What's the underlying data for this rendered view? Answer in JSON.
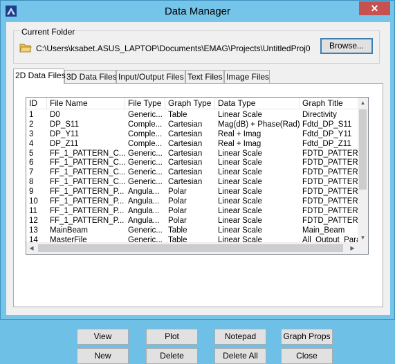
{
  "window": {
    "title": "Data Manager",
    "close_glyph": "✕"
  },
  "folder": {
    "legend": "Current Folder",
    "path": "C:\\Users\\ksabet.ASUS_LAPTOP\\Documents\\EMAG\\Projects\\UntitledProj0",
    "browse_label": "Browse..."
  },
  "tabs": [
    {
      "label": "2D Data Files",
      "active": true
    },
    {
      "label": "3D Data Files",
      "active": false
    },
    {
      "label": "Input/Output Files",
      "active": false
    },
    {
      "label": "Text Files",
      "active": false
    },
    {
      "label": "Image Files",
      "active": false
    }
  ],
  "table": {
    "columns": [
      "ID",
      "File Name",
      "File Type",
      "Graph Type",
      "Data Type",
      "Graph Title"
    ],
    "rows": [
      [
        "1",
        "D0",
        "Generic...",
        "Table",
        "Linear Scale",
        "Directivity"
      ],
      [
        "2",
        "DP_S11",
        "Comple...",
        "Cartesian",
        "Mag(dB) + Phase(Rad)",
        "Fdtd_DP_S11"
      ],
      [
        "3",
        "DP_Y11",
        "Comple...",
        "Cartesian",
        "Real + Imag",
        "Fdtd_DP_Y11"
      ],
      [
        "4",
        "DP_Z11",
        "Comple...",
        "Cartesian",
        "Real + Imag",
        "Fdtd_DP_Z11"
      ],
      [
        "5",
        "FF_1_PATTERN_C...",
        "Generic...",
        "Cartesian",
        "Linear Scale",
        "FDTD_PATTERN"
      ],
      [
        "6",
        "FF_1_PATTERN_C...",
        "Generic...",
        "Cartesian",
        "Linear Scale",
        "FDTD_PATTERN"
      ],
      [
        "7",
        "FF_1_PATTERN_C...",
        "Generic...",
        "Cartesian",
        "Linear Scale",
        "FDTD_PATTERN"
      ],
      [
        "8",
        "FF_1_PATTERN_C...",
        "Generic...",
        "Cartesian",
        "Linear Scale",
        "FDTD_PATTERN"
      ],
      [
        "9",
        "FF_1_PATTERN_P...",
        "Angula...",
        "Polar",
        "Linear Scale",
        "FDTD_PATTERN"
      ],
      [
        "10",
        "FF_1_PATTERN_P...",
        "Angula...",
        "Polar",
        "Linear Scale",
        "FDTD_PATTERN"
      ],
      [
        "11",
        "FF_1_PATTERN_P...",
        "Angula...",
        "Polar",
        "Linear Scale",
        "FDTD_PATTERN"
      ],
      [
        "12",
        "FF_1_PATTERN_P...",
        "Angula...",
        "Polar",
        "Linear Scale",
        "FDTD_PATTERN"
      ],
      [
        "13",
        "MainBeam",
        "Generic...",
        "Table",
        "Linear Scale",
        "Main_Beam"
      ],
      [
        "14",
        "MasterFile",
        "Generic...",
        "Table",
        "Linear Scale",
        "All_Output_Para"
      ]
    ]
  },
  "buttons": {
    "view": "View",
    "plot": "Plot",
    "notepad": "Notepad",
    "graph_props": "Graph Props",
    "new": "New",
    "delete": "Delete",
    "delete_all": "Delete All",
    "close": "Close"
  },
  "icons": {
    "app": "app-icon",
    "folder": "folder-icon"
  },
  "colors": {
    "titlebar": "#75c4e9",
    "close": "#c75050",
    "focus_border": "#3c7fb1"
  }
}
